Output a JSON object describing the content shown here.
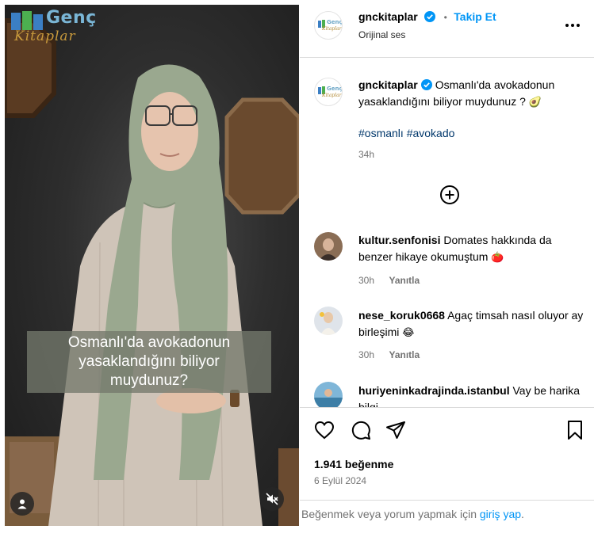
{
  "video": {
    "logo_word": "Genç",
    "logo_script": "Kitaplar",
    "caption": "Osmanlı'da avokadonun yasaklandığını biliyor muydunuz?",
    "icons": {
      "user": "user-icon",
      "mute": "speaker-muted-icon"
    }
  },
  "header": {
    "username": "gnckitaplar",
    "separator": "•",
    "follow_label": "Takip Et",
    "audio_label": "Orijinal ses",
    "avatar_word": "Genç",
    "avatar_script": "Kitaplar",
    "more_icon": "more-horizontal-icon",
    "verified_icon": "verified-badge-icon"
  },
  "post": {
    "username": "gnckitaplar",
    "caption": "Osmanlı'da avokadonun yasaklandığını biliyor muydunuz ?",
    "caption_emoji": "🥑",
    "hashtags": [
      "#osmanlı",
      "#avokado"
    ],
    "time": "34h",
    "load_more_icon": "plus-circle-icon"
  },
  "comments": [
    {
      "username": "kultur.senfonisi",
      "text": "Domates hakkında da benzer hikaye okumuştum",
      "emoji": "🍅",
      "time": "30h",
      "reply_label": "Yanıtla"
    },
    {
      "username": "nese_koruk0668",
      "text": "Agaç timsah nasıl oluyor ay birleşimi",
      "emoji": "😂",
      "time": "30h",
      "reply_label": "Yanıtla"
    },
    {
      "username": "huriyeninkadrajinda.istanbul",
      "text": "Vay be harika bilgi",
      "emoji": "",
      "time": "",
      "reply_label": ""
    }
  ],
  "actions": {
    "like_icon": "heart-icon",
    "comment_icon": "comment-icon",
    "share_icon": "send-icon",
    "save_icon": "bookmark-icon",
    "likes": "1.941 beğenme",
    "date": "6 Eylül 2024"
  },
  "footer": {
    "prompt": "Beğenmek veya yorum yapmak için",
    "login_link": "giriş yap",
    "end": "."
  },
  "colors": {
    "accent": "#0095f6",
    "muted": "#737373",
    "hashtag": "#00376b",
    "divider": "#dbdbdb",
    "scarf": "#9aa88f",
    "shirt": "#cfc4b8"
  }
}
